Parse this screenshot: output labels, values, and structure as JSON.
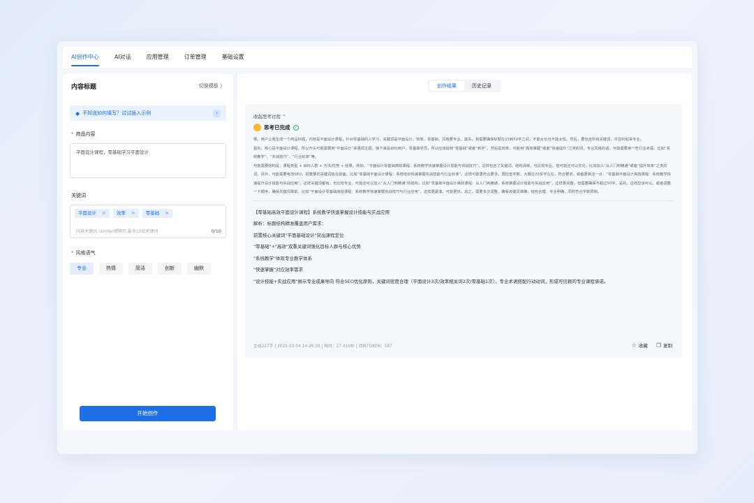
{
  "nav": {
    "tabs": [
      {
        "label": "AI创作中心"
      },
      {
        "label": "AI对话"
      },
      {
        "label": "应用管理"
      },
      {
        "label": "订单管理"
      },
      {
        "label": "基础设置"
      }
    ]
  },
  "left": {
    "title": "内容标题",
    "switch_template": "切换模板 〉",
    "hint": "不知道如何填写？试试插入示例",
    "product_label": "商品内容",
    "product_value": "平面设计课程，零基础学习平面设计",
    "keywords_label": "关键词",
    "keywords": [
      "平面设计",
      "效率",
      "零基础"
    ],
    "keywords_placeholder": "内容关键词,以enter键隔开,最多10组关键词",
    "keywords_count": "0/10",
    "style_label": "风格语气",
    "styles": [
      "专业",
      "热情",
      "简洁",
      "创新",
      "幽默"
    ],
    "start_button": "开始创作"
  },
  "right": {
    "tabs": [
      "创作结果",
      "历史记录"
    ],
    "think_header": "收起思考过程 ^",
    "think_status": "思考已完成",
    "think_paragraphs": [
      "嗯，用户让我生成一个商品标题，内容是平面设计课程，针对零基础的人学习，关键词是平面设计、效率、零基础，风格要专业。首先，我需要确保标题在15到50字之间，不能太长也不能太短。然后，要包含所有关键词，并且听起来专业。",
      "首先，核心是平面设计课程，所以开头可能需要用“平面设计”来强调主题。接下来是目标用户，零基础学员，所以应该提到“零基础”或者“新手”。然后是效率，可能用“高效掌握”或者“快速提升”之类的词。专业风格的话，可能需要用一些行业术语，比如“系统教学”、“实战技巧”、“行业标准”等。",
      "可能需要结构是：课程类型 + 目标人群 + 方法/优势 + 结果。例如，“平面设计零基础高效课程：系统教学快速掌握设计技能与实战技巧”。这样包含了关键词，结构清晰，也比较专业。但可能还可以优化，比如加入“从入门到精通”或者“提升效率”之类的词。另外，可能需要考虑SEO，把重要的关键词放在前面。比如“零基础平面设计课程：系统培训快速掌握实战技能与行业标准”。这样可能更符合要求。再检查字数，大概在20多字左右，符合要求。或者更简洁一点：“零基础平面设计高效课程：系统教学快速提升设计技能与实战应用”。这样关键词都有，也比较专业。可能还可以加入“从入门到精通”的结构，比如“零基础平面设计高效课程：从入门到精通，系统掌握设计技能与实战应用”。这样更完整，但需要确保不超过50字。是的，这样应该可以。或者调整一下顺序，确保关键词靠前。比如“平面设计零基础高效课程：系统教学快速掌握实战技巧与行业应用”。这样更紧凑，可能更好。总之，需要多次调整，确保关键词准确，结构合理，专业明确，同时符合字数限制。"
    ],
    "answer": [
      "【零基础高效平面设计课程】系统教学快速掌握设计技能与实战应用",
      "解析：标题结构精准覆盖用户需求：",
      "前置核心关键词\"平面基础设计\"突出课程定位",
      "\"零基础\"+\"高效\"双重关键词强化目标人群与核心优势",
      "\"系统教学\"体现专业教学体系",
      "\"快速掌握\"对应效率需求",
      "\"设计技能+实战应用\"展示专业成果导向 符合SEO优化原则，关键词密度合理（平面设计3次/效率相关词2次/零基础1次），专业术语搭配行动动词，形成可信赖的专业课程承诺。"
    ],
    "meta": "生成227字 | 2025-03-04 14:28:30 | 耗时：27.416秒 | 消耗TOKEN：587",
    "favorite": "收藏",
    "copy": "复制"
  }
}
